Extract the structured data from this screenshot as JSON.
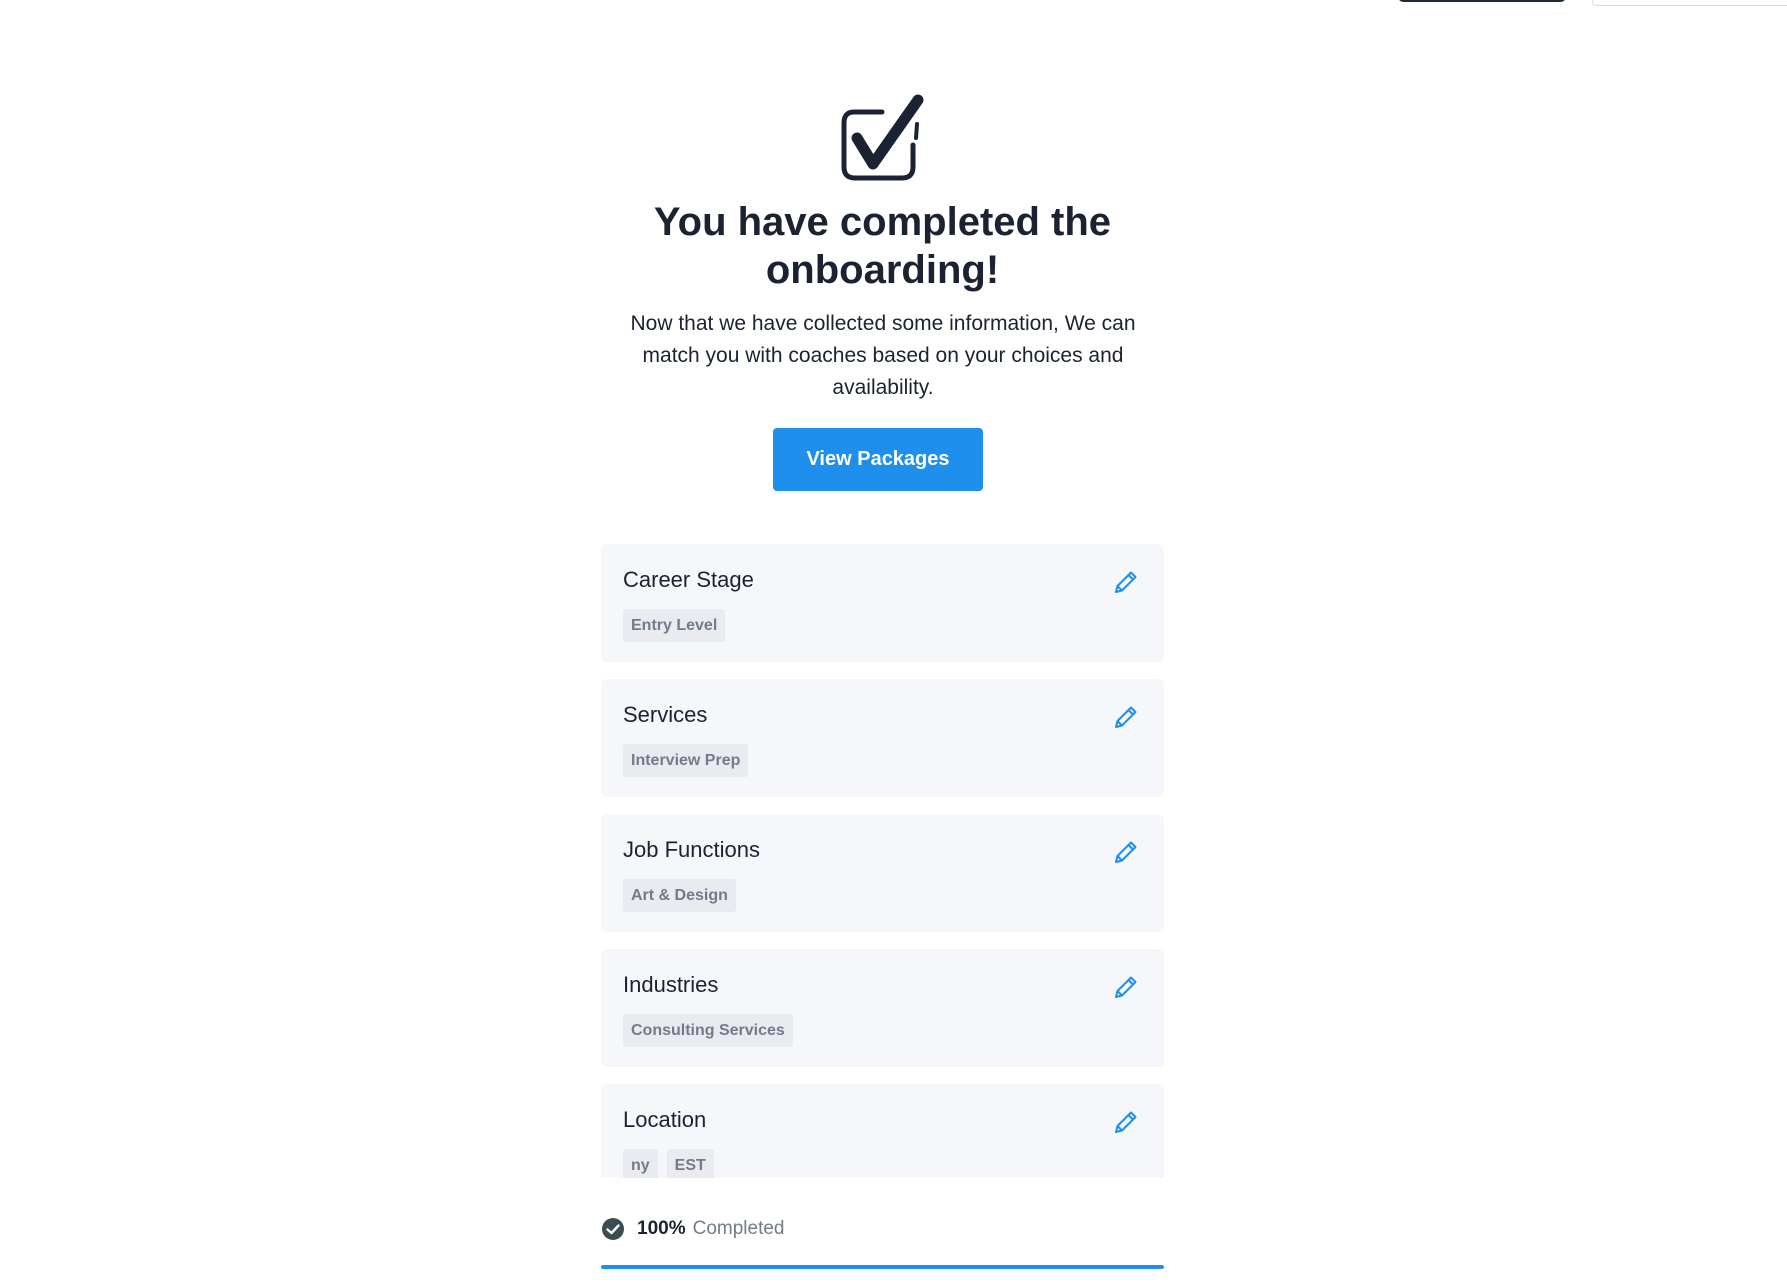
{
  "colors": {
    "text": "#1b2333",
    "accent": "#1e8fec",
    "card_bg": "#f6f7fb",
    "tag_bg": "#e9ebf1",
    "tag_text": "#737b8a"
  },
  "hero": {
    "icon": "checkbox-check-icon",
    "title": "You have completed the onboarding!",
    "description": "Now that we have collected some information, We can match you with coaches based on your choices and availability.",
    "cta_label": "View Packages"
  },
  "sections": [
    {
      "title": "Career Stage",
      "edit_icon": "pencil-icon",
      "tags": [
        "Entry Level"
      ]
    },
    {
      "title": "Services",
      "edit_icon": "pencil-icon",
      "tags": [
        "Interview Prep"
      ]
    },
    {
      "title": "Job Functions",
      "edit_icon": "pencil-icon",
      "tags": [
        "Art & Design"
      ]
    },
    {
      "title": "Industries",
      "edit_icon": "pencil-icon",
      "tags": [
        "Consulting Services"
      ]
    },
    {
      "title": "Location",
      "edit_icon": "pencil-icon",
      "tags": [
        "ny",
        "EST"
      ]
    }
  ],
  "progress": {
    "icon": "check-circle-icon",
    "percent_text": "100%",
    "label": "Completed",
    "value": 1.0
  }
}
